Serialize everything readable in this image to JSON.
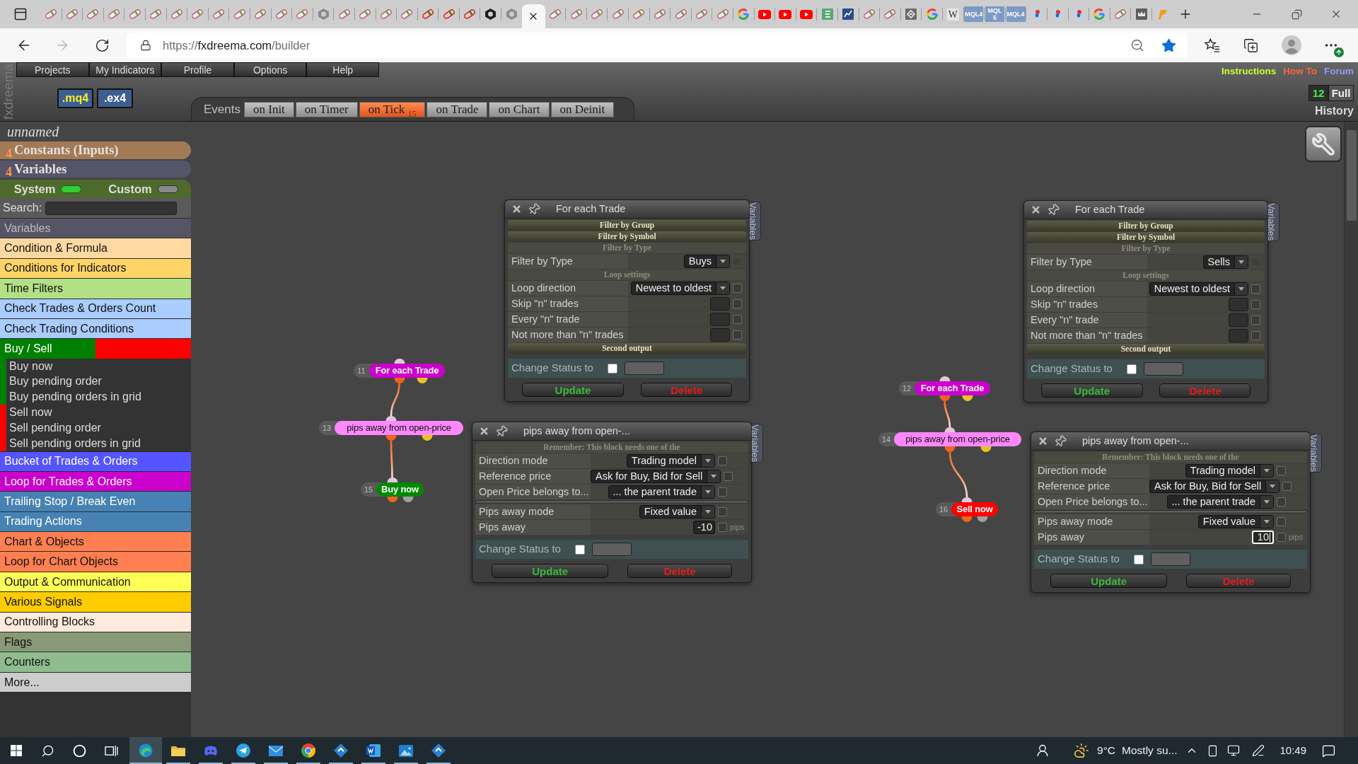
{
  "browser": {
    "tabs": [
      {
        "kind": "capsule",
        "selected": false
      },
      {
        "kind": "capsule",
        "selected": false
      },
      {
        "kind": "capsule",
        "selected": false
      },
      {
        "kind": "capsule",
        "selected": false
      },
      {
        "kind": "capsule",
        "selected": false
      },
      {
        "kind": "capsule",
        "selected": false
      },
      {
        "kind": "capsule",
        "selected": false
      },
      {
        "kind": "capsule",
        "selected": false
      },
      {
        "kind": "capsule",
        "selected": false
      },
      {
        "kind": "capsule",
        "selected": false
      },
      {
        "kind": "capsule",
        "selected": false
      },
      {
        "kind": "capsule",
        "selected": false
      },
      {
        "kind": "capsule",
        "selected": false
      },
      {
        "kind": "nut",
        "selected": false
      },
      {
        "kind": "capsule",
        "selected": false
      },
      {
        "kind": "capsule",
        "selected": false
      },
      {
        "kind": "capsule",
        "selected": false
      },
      {
        "kind": "capsule",
        "selected": false
      },
      {
        "kind": "capsule-red",
        "selected": false
      },
      {
        "kind": "capsule-red",
        "selected": false
      },
      {
        "kind": "capsule-red",
        "selected": false
      },
      {
        "kind": "nut-dark",
        "selected": false
      },
      {
        "kind": "nut",
        "selected": false
      },
      {
        "selected": true
      },
      {
        "kind": "capsule",
        "selected": false
      },
      {
        "kind": "capsule",
        "selected": false
      },
      {
        "kind": "capsule",
        "selected": false
      },
      {
        "kind": "capsule",
        "selected": false
      },
      {
        "kind": "capsule",
        "selected": false
      },
      {
        "kind": "capsule",
        "selected": false
      },
      {
        "kind": "capsule",
        "selected": false
      },
      {
        "kind": "capsule",
        "selected": false
      },
      {
        "kind": "capsule",
        "selected": false
      },
      {
        "kind": "g-logo",
        "selected": false
      },
      {
        "kind": "play",
        "selected": false
      },
      {
        "kind": "play",
        "selected": false
      },
      {
        "kind": "play",
        "selected": false
      },
      {
        "kind": "sheet",
        "selected": false
      },
      {
        "kind": "chart",
        "selected": false
      },
      {
        "kind": "capsule",
        "selected": false
      },
      {
        "kind": "capsule",
        "selected": false
      },
      {
        "kind": "diamond",
        "selected": false
      },
      {
        "kind": "g-logo",
        "selected": false
      },
      {
        "kind": "letter-tile",
        "glyph": "W",
        "selected": false
      },
      {
        "kind": "mql-tile",
        "glyph": "MQL4",
        "selected": false
      },
      {
        "kind": "mql-tile",
        "glyph": "MQL 5",
        "selected": false
      },
      {
        "kind": "mql-tile",
        "glyph": "MQL4",
        "selected": false
      },
      {
        "kind": "bubble",
        "selected": false
      },
      {
        "kind": "bubble",
        "selected": false
      },
      {
        "kind": "bubble",
        "selected": false
      },
      {
        "kind": "g-logo",
        "selected": false
      },
      {
        "kind": "capsule",
        "selected": false
      },
      {
        "kind": "crown",
        "selected": false
      },
      {
        "kind": "swoosh",
        "selected": false
      }
    ],
    "address": {
      "scheme": "https://",
      "host": "fxdreema.com",
      "path": "/builder"
    },
    "bookmarked": true
  },
  "app": {
    "logo": "fxdreema",
    "menu": [
      "Projects",
      "My Indicators",
      "Profile",
      "Options",
      "Help"
    ],
    "exports": [
      {
        "label": ".mq4",
        "kind": "mq4"
      },
      {
        "label": ".ex4",
        "kind": "ex4"
      }
    ],
    "events": {
      "label": "Events",
      "tabs": [
        {
          "label": "on Init",
          "selected": false
        },
        {
          "label": "on Timer",
          "selected": false
        },
        {
          "label": "on Tick",
          "count": "15",
          "selected": true
        },
        {
          "label": "on Trade",
          "selected": false
        },
        {
          "label": "on Chart",
          "selected": false
        },
        {
          "label": "on Deinit",
          "selected": false
        }
      ]
    },
    "links": [
      {
        "label": "Instructions",
        "color": "#ccff33"
      },
      {
        "label": "How To",
        "color": "#ff6633"
      },
      {
        "label": "Forum",
        "color": "#9999ff"
      }
    ],
    "history": {
      "count": "12",
      "mode": "Full",
      "label": "History"
    }
  },
  "sidebar": {
    "project_name": "unnamed",
    "sections": [
      {
        "count": "4",
        "label": "Constants (Inputs)",
        "color": "#a27a56"
      },
      {
        "count": "4",
        "label": "Variables",
        "color": "#55556a"
      }
    ],
    "toggles": [
      {
        "label": "System",
        "on": true
      },
      {
        "label": "Custom",
        "on": false
      }
    ],
    "search_label": "Search:",
    "categories": [
      {
        "kind": "muted",
        "label": "Variables",
        "color": "#555566"
      },
      {
        "kind": "item",
        "label": "Condition & Formula",
        "color": "#ffd9a1"
      },
      {
        "kind": "item",
        "label": "Conditions for Indicators",
        "color": "#ffd466"
      },
      {
        "kind": "item",
        "label": "Time Filters",
        "color": "#b2e084"
      },
      {
        "kind": "item",
        "label": "Check Trades & Orders Count",
        "color": "#aaccff"
      },
      {
        "kind": "item",
        "label": "Check Trading Conditions",
        "color": "#aaccff"
      },
      {
        "kind": "group",
        "label": "Buy / Sell",
        "segments": [
          {
            "color": "#008000"
          },
          {
            "color": "#ff0000"
          }
        ],
        "children": [
          {
            "label": "Buy now",
            "color": "#008000"
          },
          {
            "label": "Buy pending order",
            "color": "#008000"
          },
          {
            "label": "Buy pending orders in grid",
            "color": "#008000"
          },
          {
            "label": "Sell now",
            "color": "#ff0000"
          },
          {
            "label": "Sell pending order",
            "color": "#ff0000"
          },
          {
            "label": "Sell pending orders in grid",
            "color": "#ff0000"
          }
        ]
      },
      {
        "kind": "item",
        "label": "Bucket of Trades & Orders",
        "color": "#5555ff"
      },
      {
        "kind": "item",
        "label": "Loop for Trades & Orders",
        "color": "#cc00cc"
      },
      {
        "kind": "item",
        "label": "Trailing Stop / Break Even",
        "color": "#4682b4"
      },
      {
        "kind": "item",
        "label": "Trading Actions",
        "color": "#4682b4"
      },
      {
        "kind": "item",
        "label": "Chart & Objects",
        "color": "#ff7f50"
      },
      {
        "kind": "item",
        "label": "Loop for Chart Objects",
        "color": "#ff7f50"
      },
      {
        "kind": "item",
        "label": "Output & Communication",
        "color": "#ffff55"
      },
      {
        "kind": "item",
        "label": "Various Signals",
        "color": "#ffcc00"
      },
      {
        "kind": "item",
        "label": "Controlling Blocks",
        "color": "#ffeadb"
      },
      {
        "kind": "item",
        "label": "Flags",
        "color": "#889977"
      },
      {
        "kind": "item",
        "label": "Counters",
        "color": "#8fbc8f"
      },
      {
        "kind": "item",
        "label": "More...",
        "color": "#cccccc"
      }
    ]
  },
  "canvas": {
    "flows": [
      {
        "number": "11",
        "label": "For each Trade",
        "color": "#cc00cc",
        "outputs": [
          {
            "color": "#f0641e"
          },
          {
            "color": "#e8c420"
          }
        ],
        "children": [
          {
            "number": "13",
            "label": "pips away from open-price",
            "color": "#ff88ff",
            "outputs": [
              {
                "color": "#f0641e"
              },
              {
                "color": "#e8c420"
              }
            ],
            "children": [
              {
                "number": "15",
                "label": "Buy now",
                "color": "#008800",
                "outputs": [
                  {
                    "color": "#f0641e"
                  },
                  {
                    "color": "#a0a0a0"
                  }
                ]
              }
            ]
          }
        ]
      },
      {
        "number": "12",
        "label": "For each Trade",
        "color": "#cc00cc",
        "outputs": [
          {
            "color": "#f0641e"
          },
          {
            "color": "#e8c420"
          }
        ],
        "children": [
          {
            "number": "14",
            "label": "pips away from open-price",
            "color": "#ff88ff",
            "outputs": [
              {
                "color": "#f0641e"
              },
              {
                "color": "#e8c420"
              }
            ],
            "children": [
              {
                "number": "16",
                "label": "Sell now",
                "color": "#ff0000",
                "outputs": [
                  {
                    "color": "#f0641e"
                  },
                  {
                    "color": "#a0a0a0"
                  }
                ]
              }
            ]
          }
        ]
      }
    ],
    "dialogs": [
      {
        "title": "For each Trade",
        "side_tab": "Variables",
        "rows": [
          {
            "kind": "section",
            "label": "Filter by Group",
            "expanded": false
          },
          {
            "kind": "section",
            "label": "Filter by Symbol",
            "expanded": false
          },
          {
            "kind": "section",
            "label": "Filter by Type",
            "expanded": true
          },
          {
            "kind": "select",
            "label": "Filter by Type",
            "value": "Buys",
            "checked": false,
            "disabled": true
          },
          {
            "kind": "section",
            "label": "Loop settings",
            "expanded": true
          },
          {
            "kind": "select",
            "label": "Loop direction",
            "value": "Newest to oldest",
            "checked": false,
            "disabled": false
          },
          {
            "kind": "input",
            "label": "Skip \"n\" trades",
            "checked": false,
            "disabled": false
          },
          {
            "kind": "input",
            "label": "Every \"n\" trade",
            "checked": false,
            "disabled": false
          },
          {
            "kind": "input",
            "label": "Not more than \"n\" trades",
            "checked": false,
            "disabled": false
          },
          {
            "kind": "section",
            "label": "Second output",
            "expanded": false
          }
        ],
        "status": {
          "label": "Change Status to",
          "checked": false
        },
        "buttons": [
          {
            "label": "Update",
            "kind": "update"
          },
          {
            "label": "Delete",
            "kind": "delete"
          }
        ]
      },
      {
        "title": "pips away from open-...",
        "side_tab": "Variables",
        "rows": [
          {
            "kind": "section",
            "label": "Remember: This block needs one of the",
            "expanded": true
          },
          {
            "kind": "select",
            "label": "Direction mode",
            "value": "Trading model",
            "checked": false,
            "disabled": false
          },
          {
            "kind": "select",
            "label": "Reference price",
            "value": "Ask for Buy, Bid for Sell",
            "checked": false,
            "disabled": false
          },
          {
            "kind": "select",
            "label": "Open Price belongs to...",
            "value": "... the parent trade",
            "checked": false,
            "disabled": false
          },
          {
            "kind": "divider"
          },
          {
            "kind": "select",
            "label": "Pips away mode",
            "value": "Fixed value",
            "checked": false,
            "disabled": false
          },
          {
            "kind": "number",
            "label": "Pips away",
            "value": "-10",
            "unit": "pips",
            "focused": false,
            "checked": false,
            "disabled": false
          }
        ],
        "status": {
          "label": "Change Status to",
          "checked": false
        },
        "buttons": [
          {
            "label": "Update",
            "kind": "update"
          },
          {
            "label": "Delete",
            "kind": "delete"
          }
        ]
      },
      {
        "title": "For each Trade",
        "side_tab": "Variables",
        "rows": [
          {
            "kind": "section",
            "label": "Filter by Group",
            "expanded": false
          },
          {
            "kind": "section",
            "label": "Filter by Symbol",
            "expanded": false
          },
          {
            "kind": "section",
            "label": "Filter by Type",
            "expanded": true
          },
          {
            "kind": "select",
            "label": "Filter by Type",
            "value": "Sells",
            "checked": false,
            "disabled": true
          },
          {
            "kind": "section",
            "label": "Loop settings",
            "expanded": true
          },
          {
            "kind": "select",
            "label": "Loop direction",
            "value": "Newest to oldest",
            "checked": false,
            "disabled": false
          },
          {
            "kind": "input",
            "label": "Skip \"n\" trades",
            "checked": false,
            "disabled": false
          },
          {
            "kind": "input",
            "label": "Every \"n\" trade",
            "checked": false,
            "disabled": false
          },
          {
            "kind": "input",
            "label": "Not more than \"n\" trades",
            "checked": false,
            "disabled": false
          },
          {
            "kind": "section",
            "label": "Second output",
            "expanded": false
          }
        ],
        "status": {
          "label": "Change Status to",
          "checked": false
        },
        "buttons": [
          {
            "label": "Update",
            "kind": "update"
          },
          {
            "label": "Delete",
            "kind": "delete"
          }
        ]
      },
      {
        "title": "pips away from open-...",
        "side_tab": "Variables",
        "rows": [
          {
            "kind": "section",
            "label": "Remember: This block needs one of the",
            "expanded": true
          },
          {
            "kind": "select",
            "label": "Direction mode",
            "value": "Trading model",
            "checked": false,
            "disabled": false
          },
          {
            "kind": "select",
            "label": "Reference price",
            "value": "Ask for Buy, Bid for Sell",
            "checked": false,
            "disabled": false
          },
          {
            "kind": "select",
            "label": "Open Price belongs to...",
            "value": "... the parent trade",
            "checked": false,
            "disabled": false
          },
          {
            "kind": "divider"
          },
          {
            "kind": "select",
            "label": "Pips away mode",
            "value": "Fixed value",
            "checked": false,
            "disabled": false
          },
          {
            "kind": "number",
            "label": "Pips away",
            "value": "10",
            "unit": "pips",
            "focused": true,
            "checked": false,
            "disabled": false
          }
        ],
        "status": {
          "label": "Change Status to",
          "checked": false
        },
        "buttons": [
          {
            "label": "Update",
            "kind": "update"
          },
          {
            "label": "Delete",
            "kind": "delete"
          }
        ]
      }
    ]
  },
  "taskbar": {
    "apps": [
      {
        "kind": "edge",
        "selected": true,
        "running": true
      },
      {
        "kind": "folder",
        "selected": false,
        "running": true
      },
      {
        "kind": "gamepad",
        "selected": false,
        "running": true
      },
      {
        "kind": "plane",
        "selected": false,
        "running": true
      },
      {
        "kind": "mail",
        "selected": false,
        "running": true
      },
      {
        "kind": "wheel",
        "selected": false,
        "running": true
      },
      {
        "kind": "diamond",
        "selected": false,
        "running": true
      },
      {
        "kind": "document",
        "selected": false,
        "running": true
      },
      {
        "kind": "picture",
        "selected": false,
        "running": true
      },
      {
        "kind": "diamond",
        "selected": false,
        "running": true
      }
    ],
    "weather": {
      "temperature": "9°C",
      "summary": "Mostly su..."
    },
    "clock": "10:49"
  }
}
